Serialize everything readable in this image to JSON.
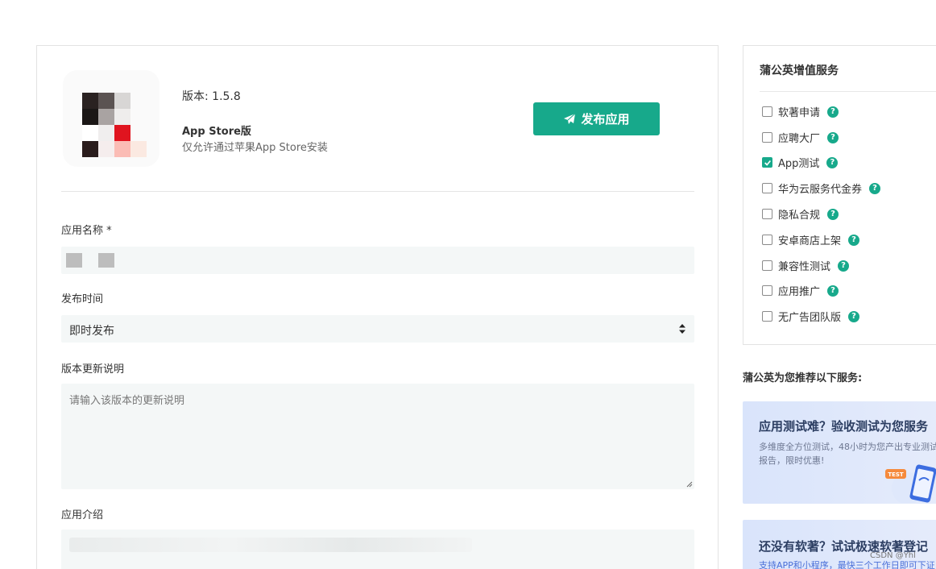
{
  "release": {
    "version_label": "版本: 1.5.8",
    "store_title": "App Store版",
    "store_desc": "仅允许通过苹果App Store安装",
    "publish_label": "发布应用"
  },
  "form": {
    "app_name_label": "应用名称 *",
    "publish_time_label": "发布时间",
    "publish_time_value": "即时发布",
    "update_notes_label": "版本更新说明",
    "update_notes_placeholder": "请输入该版本的更新说明",
    "app_intro_label": "应用介绍"
  },
  "services": {
    "title": "蒲公英增值服务",
    "items": [
      {
        "label": "软著申请",
        "checked": false
      },
      {
        "label": "应聘大厂",
        "checked": false
      },
      {
        "label": "App测试",
        "checked": true
      },
      {
        "label": "华为云服务代金券",
        "checked": false
      },
      {
        "label": "隐私合规",
        "checked": false
      },
      {
        "label": "安卓商店上架",
        "checked": false
      },
      {
        "label": "兼容性测试",
        "checked": false
      },
      {
        "label": "应用推广",
        "checked": false
      },
      {
        "label": "无广告团队版",
        "checked": false
      }
    ]
  },
  "recommend": {
    "title": "蒲公英为您推荐以下服务:",
    "promo1_title": "应用测试难？验收测试为您服务",
    "promo1_desc": "多维度全方位测试，48小时为您产出专业测试报告，限时优惠!",
    "promo1_badge": "TEST",
    "promo2_title": "还没有软著？试试极速软著登记",
    "promo2_desc": "支持APP和小程序，最快三个工作日即可下证"
  },
  "watermark": "CSDN @Yhl",
  "colors": {
    "accent": "#17a98b",
    "input_bg": "#f4f7f7"
  }
}
